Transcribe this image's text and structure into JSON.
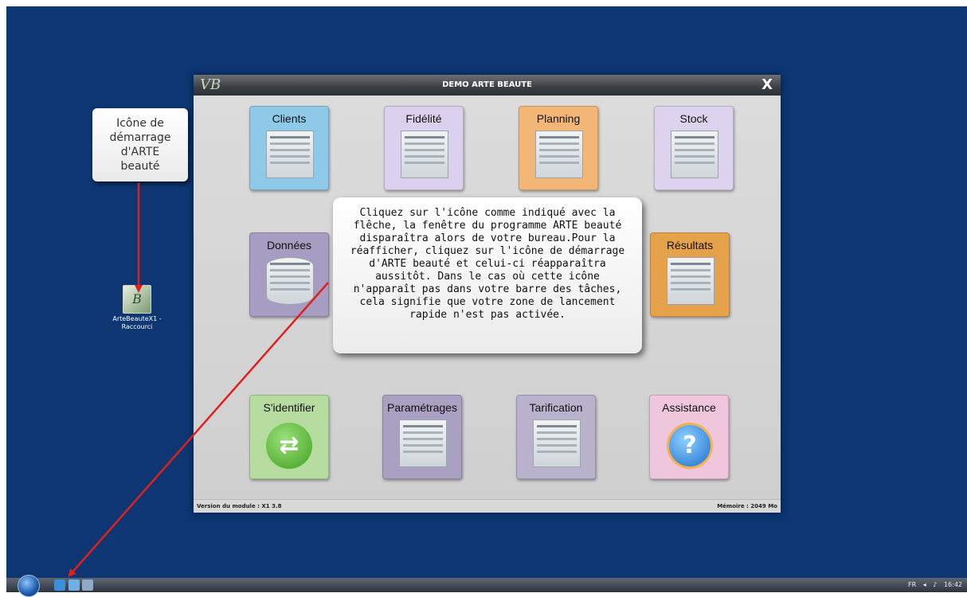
{
  "callout": {
    "text": "Icône de\ndémarrage\nd'ARTE\nbeauté"
  },
  "desktop_icon": {
    "label": "ArteBeauteX1 -\nRaccourci",
    "logo": "B"
  },
  "window": {
    "logo": "VB",
    "title": "DEMO ARTE BEAUTE",
    "close": "X",
    "status_left": "Version du module :  X1 3.8",
    "status_right": "Mémoire : 2049 Mo"
  },
  "tiles": {
    "clients": "Clients",
    "fidelite": "Fidélité",
    "planning": "Planning",
    "stock": "Stock",
    "donnees": "Données",
    "resultats": "Résultats",
    "sidentifier": "S'identifier",
    "parametrages": "Paramétrages",
    "tarification": "Tarification",
    "assistance": "Assistance"
  },
  "tile_colors": {
    "clients": "#8ec9e8",
    "fidelite": "#dcd0ef",
    "planning": "#f2b777",
    "stock": "#ddd3ee",
    "donnees": "#a79cc2",
    "resultats": "#e6a24b",
    "sidentifier": "#b6dca0",
    "parametrages": "#a9a0c2",
    "tarification": "#b8b2cc",
    "assistance": "#f0c6dc"
  },
  "icons": {
    "sidentifier": "⇄",
    "assistance": "?"
  },
  "help_bubble": "Cliquez sur l'icône comme indiqué avec la flêche, la fenêtre du programme ARTE beauté disparaîtra alors de votre bureau.Pour la réafficher, cliquez sur l'icône de démarrage d'ARTE beauté et celui-ci réapparaîtra aussitôt. Dans le cas où cette icône n'apparaît pas dans votre barre des tâches, cela signifie que votre zone de lancement rapide n'est pas activée.",
  "taskbar": {
    "tray_lang": "FR",
    "tray_time": "16:42"
  },
  "arrow_color": "#e0201c"
}
